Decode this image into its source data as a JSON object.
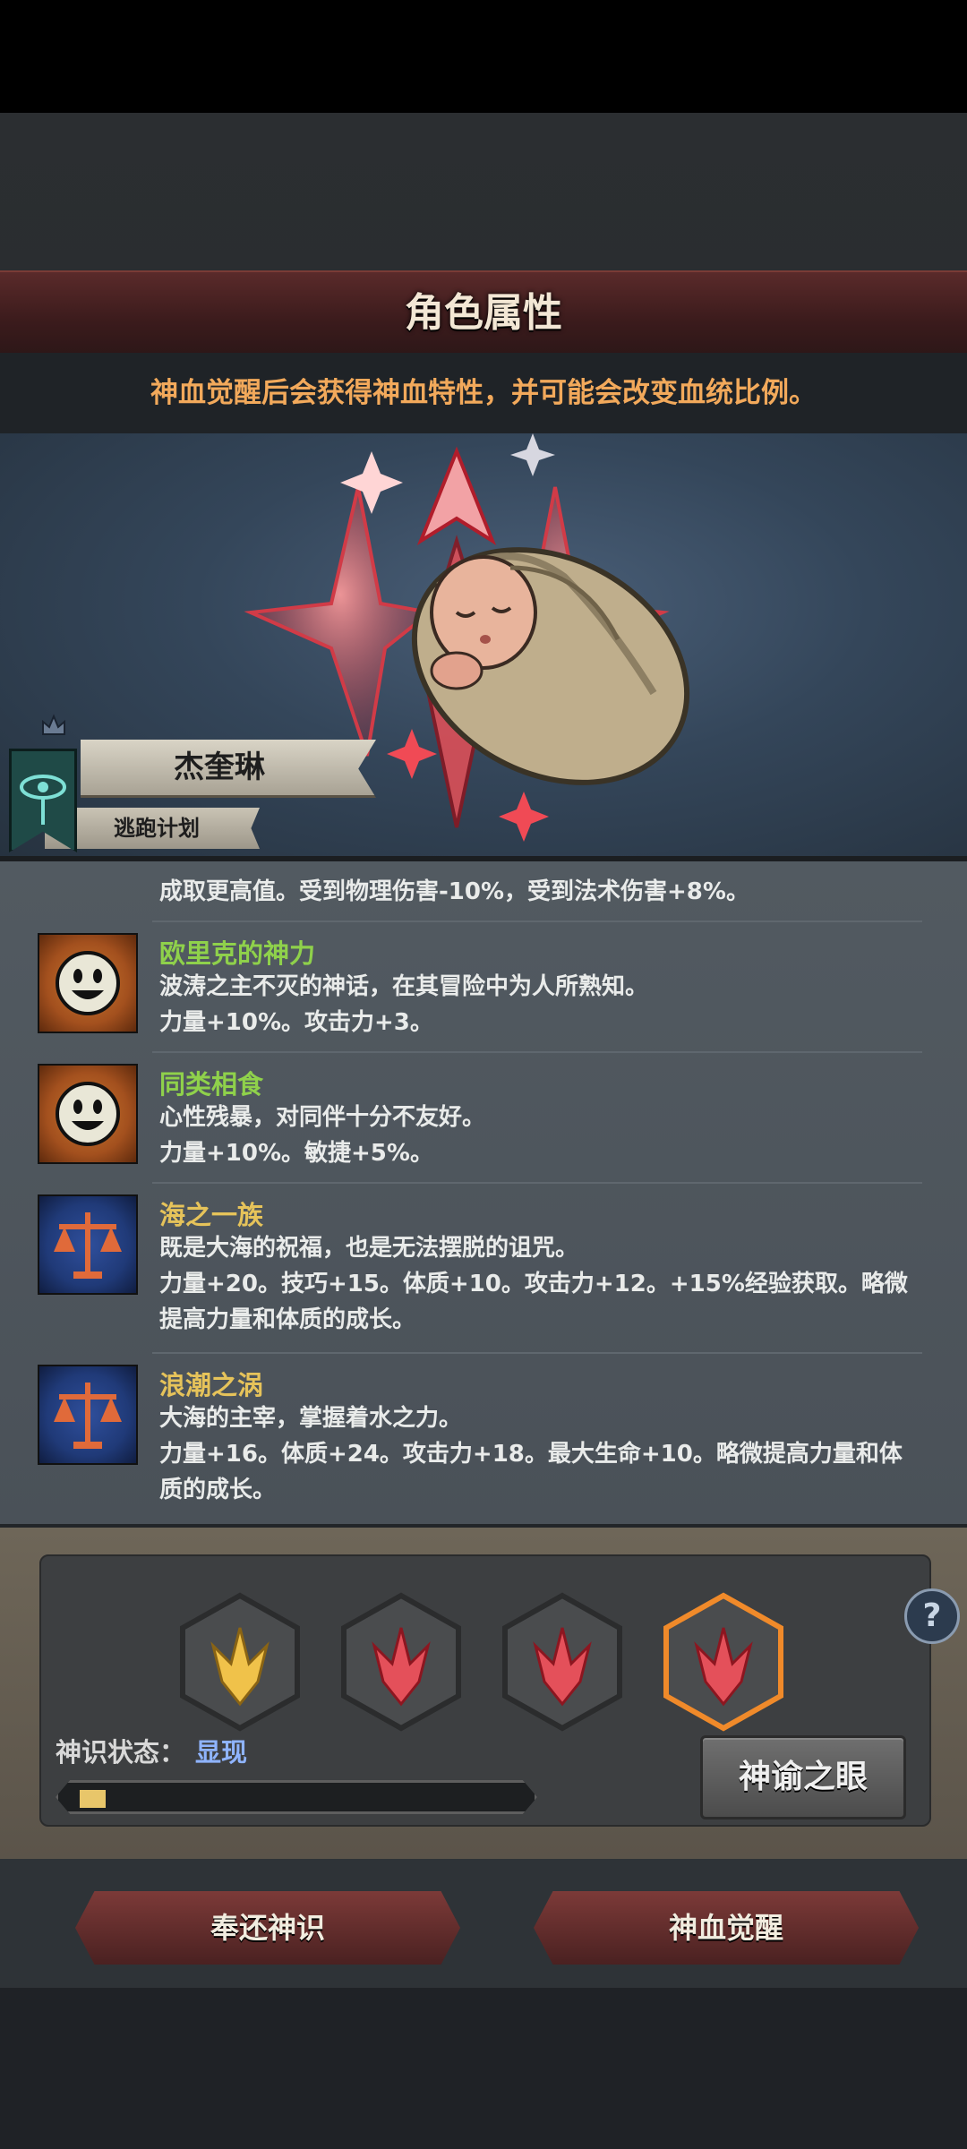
{
  "title": "角色属性",
  "hint": "神血觉醒后会获得神血特性，并可能会改变血统比例。",
  "character": {
    "name": "杰奎琳",
    "subtitle": "逃跑计划"
  },
  "traits": {
    "truncated_line": "成取更高值。受到物理伤害-10%，受到法术伤害+8%。",
    "items": [
      {
        "name": "欧里克的神力",
        "name_color": "green",
        "icon": "smile-face-icon",
        "lines": [
          "波涛之主不灭的神话，在其冒险中为人所熟知。",
          "力量+10%。攻击力+3。"
        ]
      },
      {
        "name": "同类相食",
        "name_color": "green",
        "icon": "smile-face-icon",
        "lines": [
          "心性残暴，对同伴十分不友好。",
          "力量+10%。敏捷+5%。"
        ]
      },
      {
        "name": "海之一族",
        "name_color": "yellow",
        "icon": "scales-icon",
        "lines": [
          "既是大海的祝福，也是无法摆脱的诅咒。",
          "力量+20。技巧+15。体质+10。攻击力+12。+15%经验获取。略微",
          "提高力量和体质的成长。"
        ]
      },
      {
        "name": "浪潮之涡",
        "name_color": "yellow",
        "icon": "scales-icon",
        "lines": [
          "大海的主宰，掌握着水之力。",
          "力量+16。体质+24。攻击力+18。最大生命+10。略微提高力量和体",
          "质的成长。"
        ]
      }
    ]
  },
  "awakening": {
    "state_label": "神识状态：",
    "state_value": "显现",
    "progress": 0.06,
    "oracle_button": "神谕之眼",
    "help": "?",
    "slots": [
      {
        "icon": "divine-crest-gold-icon",
        "color": "#f0c24a",
        "selected": false
      },
      {
        "icon": "divine-crest-red-icon",
        "color": "#e4505a",
        "selected": false
      },
      {
        "icon": "divine-crest-red-icon",
        "color": "#e4505a",
        "selected": false
      },
      {
        "icon": "divine-crest-red-icon",
        "color": "#e4505a",
        "selected": true
      }
    ]
  },
  "buttons": {
    "return": "奉还神识",
    "awaken": "神血觉醒"
  }
}
